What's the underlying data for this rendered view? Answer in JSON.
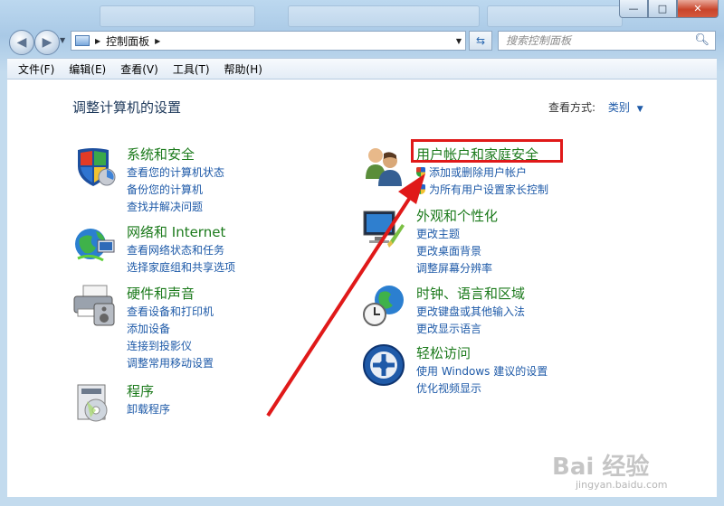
{
  "window": {
    "controls": [
      "—",
      "□",
      "✕"
    ]
  },
  "nav": {
    "address_path": "控制面板",
    "search_placeholder": "搜索控制面板"
  },
  "menu": [
    "文件(F)",
    "编辑(E)",
    "查看(V)",
    "工具(T)",
    "帮助(H)"
  ],
  "page": {
    "title": "调整计算机的设置",
    "view_by_label": "查看方式:",
    "view_by_value": "类别"
  },
  "categories_left": [
    {
      "name": "系统和安全",
      "icon": "shield-icon",
      "links": [
        "查看您的计算机状态",
        "备份您的计算机",
        "查找并解决问题"
      ]
    },
    {
      "name": "网络和 Internet",
      "icon": "network-globe-icon",
      "links": [
        "查看网络状态和任务",
        "选择家庭组和共享选项"
      ]
    },
    {
      "name": "硬件和声音",
      "icon": "printer-icon",
      "links": [
        "查看设备和打印机",
        "添加设备",
        "连接到投影仪",
        "调整常用移动设置"
      ]
    },
    {
      "name": "程序",
      "icon": "programs-icon",
      "links": [
        "卸载程序"
      ]
    }
  ],
  "categories_right": [
    {
      "name": "用户帐户和家庭安全",
      "icon": "users-icon",
      "links": [
        "添加或删除用户帐户",
        "为所有用户设置家长控制"
      ]
    },
    {
      "name": "外观和个性化",
      "icon": "monitor-brush-icon",
      "links": [
        "更改主题",
        "更改桌面背景",
        "调整屏幕分辨率"
      ]
    },
    {
      "name": "时钟、语言和区域",
      "icon": "clock-globe-icon",
      "links": [
        "更改键盘或其他输入法",
        "更改显示语言"
      ]
    },
    {
      "name": "轻松访问",
      "icon": "accessibility-icon",
      "links": [
        "使用 Windows 建议的设置",
        "优化视频显示"
      ]
    }
  ],
  "watermark": {
    "brand": "Bai 经验",
    "url": "jingyan.baidu.com"
  },
  "colors": {
    "heading_green": "#1b7a1b",
    "link_blue": "#1e5aa8",
    "highlight_red": "#e01919"
  }
}
